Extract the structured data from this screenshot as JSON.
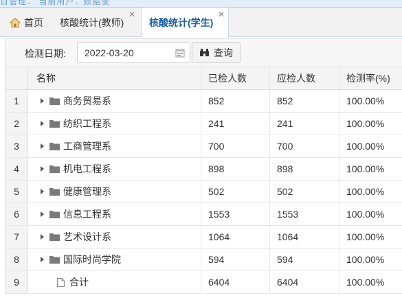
{
  "top_strip_text": "日管理：  当前用户：数据驶",
  "tabs": [
    {
      "label": "首页",
      "icon": "home-icon",
      "closable": false,
      "active": false
    },
    {
      "label": "核酸统计(教师)",
      "closable": true,
      "active": false
    },
    {
      "label": "核酸统计(学生)",
      "closable": true,
      "active": true
    }
  ],
  "toolbar": {
    "date_label": "检测日期:",
    "date_value": "2022-03-20",
    "query_label": "查询"
  },
  "table": {
    "columns": [
      "名称",
      "已检人数",
      "应检人数",
      "检测率(%)"
    ],
    "rows": [
      {
        "idx": "1",
        "name": "商务贸易系",
        "tested": "852",
        "expected": "852",
        "rate": "100.00%",
        "type": "folder"
      },
      {
        "idx": "2",
        "name": "纺织工程系",
        "tested": "241",
        "expected": "241",
        "rate": "100.00%",
        "type": "folder"
      },
      {
        "idx": "3",
        "name": "工商管理系",
        "tested": "700",
        "expected": "700",
        "rate": "100.00%",
        "type": "folder"
      },
      {
        "idx": "4",
        "name": "机电工程系",
        "tested": "898",
        "expected": "898",
        "rate": "100.00%",
        "type": "folder"
      },
      {
        "idx": "5",
        "name": "健康管理系",
        "tested": "502",
        "expected": "502",
        "rate": "100.00%",
        "type": "folder"
      },
      {
        "idx": "6",
        "name": "信息工程系",
        "tested": "1553",
        "expected": "1553",
        "rate": "100.00%",
        "type": "folder"
      },
      {
        "idx": "7",
        "name": "艺术设计系",
        "tested": "1064",
        "expected": "1064",
        "rate": "100.00%",
        "type": "folder"
      },
      {
        "idx": "8",
        "name": "国际时尚学院",
        "tested": "594",
        "expected": "594",
        "rate": "100.00%",
        "type": "folder"
      },
      {
        "idx": "9",
        "name": "合计",
        "tested": "6404",
        "expected": "6404",
        "rate": "100.00%",
        "type": "file"
      }
    ]
  },
  "colors": {
    "active_tab_text": "#1c5fa6",
    "folder": "#777777",
    "home_icon": "#d9a24a"
  }
}
